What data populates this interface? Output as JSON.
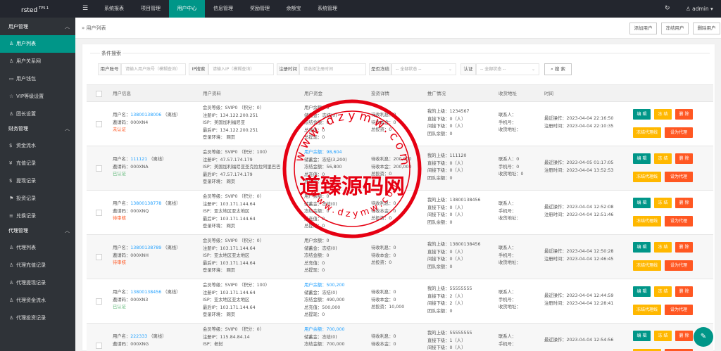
{
  "app": {
    "brand": "rsted",
    "version": "TP5.1",
    "user": "admin"
  },
  "topnav": [
    "系统报表",
    "项目管理",
    "用户中心",
    "信息管理",
    "奖励管理",
    "余额宝",
    "系统管理"
  ],
  "sidebar": {
    "groups": [
      {
        "label": "用户管理",
        "items": [
          {
            "icon": "user-icon",
            "glyph": "♙",
            "label": "用户列表"
          },
          {
            "icon": "users-icon",
            "glyph": "♙",
            "label": "用户关系网"
          },
          {
            "icon": "wallet-icon",
            "glyph": "▭",
            "label": "用户钱包"
          },
          {
            "icon": "star-icon",
            "glyph": "☆",
            "label": "VIP等级设置"
          },
          {
            "icon": "team-icon",
            "glyph": "♙",
            "label": "团长设置"
          }
        ]
      },
      {
        "label": "财务管理",
        "items": [
          {
            "icon": "money-icon",
            "glyph": "$",
            "label": "资金流水"
          },
          {
            "icon": "recharge-icon",
            "glyph": "¥",
            "label": "充值记录"
          },
          {
            "icon": "withdraw-icon",
            "glyph": "$",
            "label": "提现记录"
          },
          {
            "icon": "invest-icon",
            "glyph": "⚑",
            "label": "投资记录"
          },
          {
            "icon": "exchange-icon",
            "glyph": "≡",
            "label": "兑换记录"
          }
        ]
      },
      {
        "label": "代理管理",
        "items": [
          {
            "icon": "agent-icon",
            "glyph": "♙",
            "label": "代理列表"
          },
          {
            "icon": "agent-recharge-icon",
            "glyph": "♙",
            "label": "代理充值记录"
          },
          {
            "icon": "agent-withdraw-icon",
            "glyph": "♙",
            "label": "代理提现记录"
          },
          {
            "icon": "agent-flow-icon",
            "glyph": "♙",
            "label": "代理资金流水"
          },
          {
            "icon": "agent-invest-icon",
            "glyph": "♙",
            "label": "代理投资记录"
          }
        ]
      }
    ]
  },
  "breadcrumb": "» 用户列表",
  "toolbar": {
    "add": "添加用户",
    "freeze": "冻结用户",
    "delete": "删除用户"
  },
  "search": {
    "legend": "条件搜索",
    "account_label": "用户账号",
    "account_placeholder": "请输入用户账号（模糊查询）",
    "ip_label": "IP搜索",
    "ip_placeholder": "请输入IP（模糊查询）",
    "time_label": "注册时间",
    "time_placeholder": "请选择注册时间",
    "frozen_label": "是否冻结",
    "frozen_value": "-- 全部状态 --",
    "auth_label": "认证",
    "auth_value": "-- 全部状态 --",
    "button": "搜 索"
  },
  "table": {
    "headers": [
      "用户信息",
      "用户资料",
      "用户资金",
      "投资详情",
      "推广情况",
      "收货地址",
      "时间"
    ],
    "buttons": {
      "edit": "编 辑",
      "freeze": "冻 结",
      "del": "删 除",
      "activate_agent": "冻结代理线",
      "set_agent": "设为代理"
    },
    "rows": [
      {
        "user": {
          "name_label": "用户名：",
          "name": "13800138006",
          "status": "（离线）",
          "code": "邀请码：000XN4",
          "auth": "未认证"
        },
        "profile": [
          "会员等级：SVIP0 （积分：0）",
          "注册IP：134.122.200.251",
          "ISP：美国加利福尼亚",
          "最后IP：134.122.200.251",
          "登录环境：  网页"
        ],
        "funds": [
          "用户余额：0",
          "储蓄金：冻结(0)",
          "冻结金额：0",
          "总充值：0",
          "总提现：0"
        ],
        "invest": [
          "待收利息：0",
          "待收本金：0",
          "总投资：0"
        ],
        "promo": [
          "我的上级：1234567",
          "直接下级：0（人）",
          "间接下级：0（人）",
          "团队余额：0"
        ],
        "addr": [
          "联系人：",
          "手机号：",
          "收货地址："
        ],
        "time": [
          "最近操作：2023-04-04 22:16:50",
          "注册时间：2023-04-04 22:10:35"
        ]
      },
      {
        "user": {
          "name_label": "用户名：",
          "name": "111121",
          "status": "（离线）",
          "code": "邀请码：000XNA",
          "auth": "已认证"
        },
        "profile": [
          "会员等级：SVIP0 （积分：100）",
          "注册IP：47.57.174.179",
          "ISP：美国加利福尼亚圣克拉拉阿里巴巴",
          "最后IP：47.57.174.179",
          "登录环境：  网页"
        ],
        "funds": [
          "用户余额：98,604",
          "储蓄金：冻结(3,200)",
          "冻结金额：56,800",
          "总充值：0",
          "总提现：0"
        ],
        "invest": [
          "待收利息：200,000",
          "待收本金：200,000",
          "总投资：0"
        ],
        "promo": [
          "我的上级：111120",
          "直接下级：0（人）",
          "间接下级：0（人）",
          "团队余额：0"
        ],
        "addr": [
          "联系人：0",
          "手机号：0",
          "收货地址：0"
        ],
        "time": [
          "最近操作：2023-04-05 01:17:05",
          "注册时间：2023-04-04 13:52:53"
        ]
      },
      {
        "user": {
          "name_label": "用户名：",
          "name": "13800138778",
          "status": "（离线）",
          "code": "邀请码：000XNQ",
          "auth": "待审核"
        },
        "profile": [
          "会员等级：SVIP0 （积分：0）",
          "注册IP：103.171.144.64",
          "ISP：亚太地区亚太地区",
          "最后IP：103.171.144.64",
          "登录环境：  网页"
        ],
        "funds": [
          "用户余额：0",
          "储蓄金：冻结(0)",
          "冻结金额：0",
          "总充值：0",
          "总提现：0"
        ],
        "invest": [
          "待收利息：0",
          "待收本金：0",
          "总投资：0"
        ],
        "promo": [
          "我的上级：13800138456",
          "直接下级：0（人）",
          "间接下级：0（人）",
          "团队余额：0"
        ],
        "addr": [
          "联系人：",
          "手机号：",
          "收货地址："
        ],
        "time": [
          "最近操作：2023-04-04 12:52:08",
          "注册时间：2023-04-04 12:51:46"
        ]
      },
      {
        "user": {
          "name_label": "用户名：",
          "name": "13800138789",
          "status": "（离线）",
          "code": "邀请码：000XNH",
          "auth": "待审核"
        },
        "profile": [
          "会员等级：SVIP0 （积分：0）",
          "注册IP：103.171.144.64",
          "ISP：亚太地区亚太地区",
          "最后IP：103.171.144.64",
          "登录环境：  网页"
        ],
        "funds": [
          "用户余额：0",
          "储蓄金：冻结(0)",
          "冻结金额：0",
          "总充值：0",
          "总提现：0"
        ],
        "invest": [
          "待收利息：0",
          "待收本金：0",
          "总投资：0"
        ],
        "promo": [
          "我的上级：13800138456",
          "直接下级：0（人）",
          "间接下级：0（人）",
          "团队余额：0"
        ],
        "addr": [
          "联系人：",
          "手机号：",
          "收货地址："
        ],
        "time": [
          "最近操作：2023-04-04 12:50:28",
          "注册时间：2023-04-04 12:46:45"
        ]
      },
      {
        "user": {
          "name_label": "用户名：",
          "name": "13800138456",
          "status": "（离线）",
          "code": "邀请码：000XN3",
          "auth": "已认证"
        },
        "profile": [
          "会员等级：SVIP0 （积分：100）",
          "注册IP：103.171.144.64",
          "ISP：亚太地区亚太地区",
          "最后IP：103.171.144.64",
          "登录环境：  网页"
        ],
        "funds": [
          "用户余额：500,200",
          "储蓄金：冻结(0)",
          "冻结金额：490,000",
          "总充值：500,000",
          "总提现：0"
        ],
        "invest": [
          "待收利息：0",
          "待收本金：0",
          "总投资：10,000"
        ],
        "promo": [
          "我的上级：55555555",
          "直接下级：2（人）",
          "间接下级：2（人）",
          "团队余额：0"
        ],
        "addr": [
          "联系人：",
          "手机号：",
          "收货地址："
        ],
        "time": [
          "最近操作：2023-04-04 12:44:59",
          "注册时间：2023-04-04 12:28:41"
        ]
      },
      {
        "user": {
          "name_label": "用户名：",
          "name": "222333",
          "status": "（离线）",
          "code": "邀请码：000XNG",
          "auth": ""
        },
        "profile": [
          "会员等级：SVIP0 （积分：0）",
          "注册IP：115.84.84.14",
          "ISP：老挝",
          "",
          ""
        ],
        "funds": [
          "用户余额：700,000",
          "储蓄金：冻结(0)",
          "冻结金额：700,000",
          "",
          ""
        ],
        "invest": [
          "待收利息：0",
          "待收本金：0",
          ""
        ],
        "promo": [
          "我的上级：55555555",
          "直接下级：1（人）",
          "间接下级：0（人）",
          ""
        ],
        "addr": [
          "联系人：",
          "手机号：",
          ""
        ],
        "time": [
          "最近操作：2023-04-04 12:54:56",
          ""
        ]
      }
    ]
  },
  "watermark": {
    "url_text": "www.dzymw.com",
    "name": "道臻源码网"
  },
  "colors": {
    "topbar": "#23262e",
    "sidebar": "#2f3338",
    "accent": "#009688",
    "blue": "#1e9fff",
    "red": "#ff5722",
    "orange": "#ffb800",
    "seal": "#e60012"
  }
}
